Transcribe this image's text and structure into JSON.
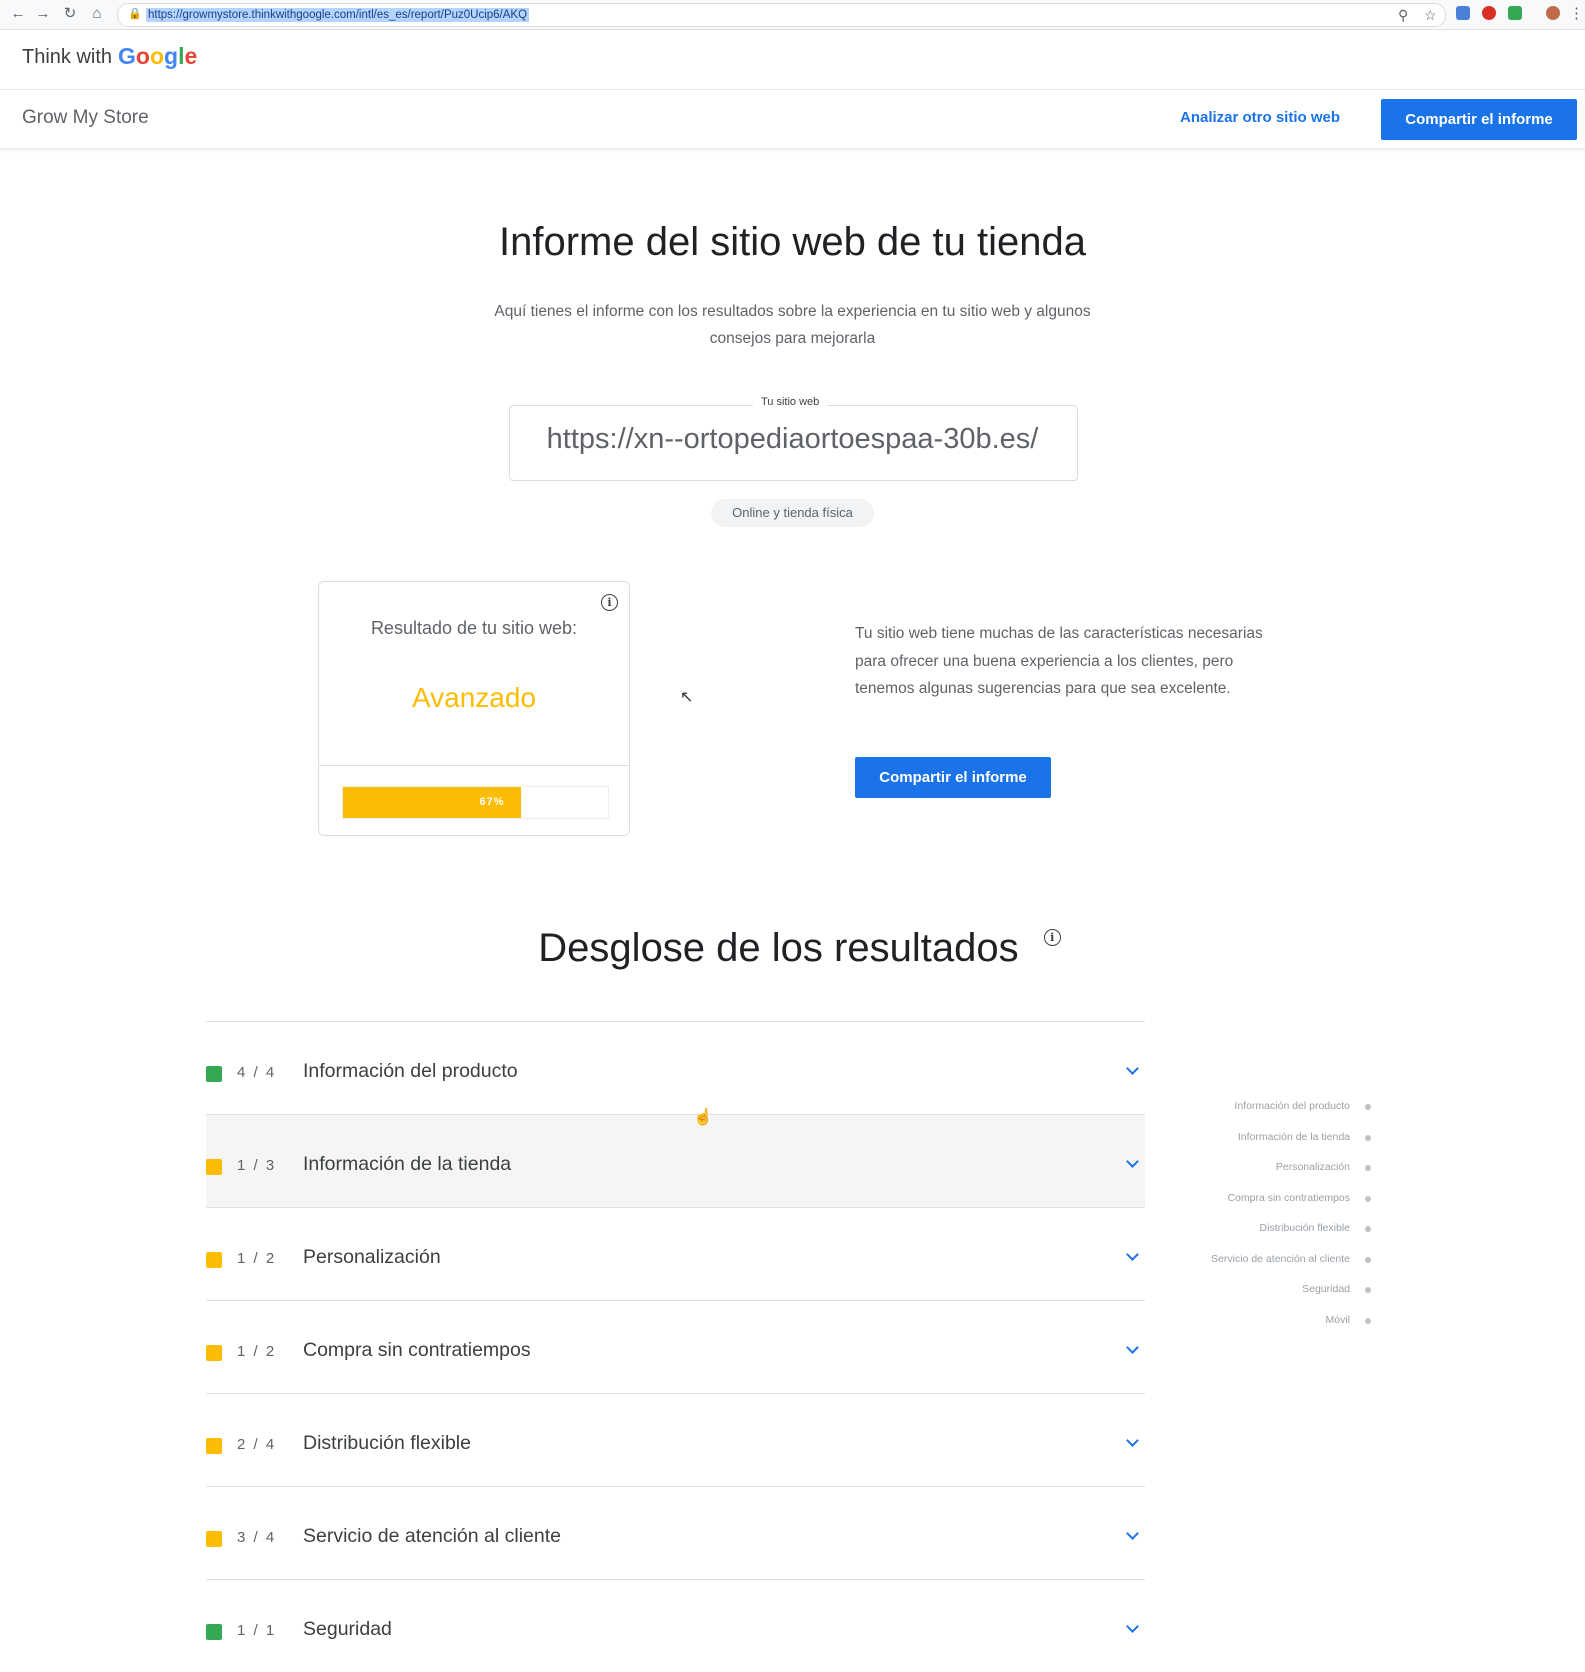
{
  "browser": {
    "url": "https://growmystore.thinkwithgoogle.com/intl/es_es/report/Puz0Ucip6/AKQ"
  },
  "brand": {
    "think_with": "Think with",
    "google": "Google"
  },
  "app_bar": {
    "title": "Grow My Store",
    "analyze_link": "Analizar otro sitio web",
    "share_button": "Compartir el informe"
  },
  "hero": {
    "title": "Informe del sitio web de tu tienda",
    "subtitle": "Aquí tienes el informe con los resultados sobre la experiencia en tu sitio web y algunos consejos para mejorarla",
    "site_label": "Tu sitio web",
    "site_url": "https://xn--ortopediaortoespaa-30b.es/",
    "store_type": "Online y tienda física"
  },
  "score_card": {
    "label": "Resultado de tu sitio web:",
    "value": "Avanzado",
    "progress_percent": 67,
    "progress_text": "67%"
  },
  "summary": {
    "text": "Tu sitio web tiene muchas de las características necesarias para ofrecer una buena experiencia a los clientes, pero tenemos algunas sugerencias para que sea excelente.",
    "share_button": "Compartir el informe"
  },
  "breakdown": {
    "title": "Desglose de los resultados",
    "rows": [
      {
        "score": "4 / 4",
        "name": "Información del producto",
        "status_color": "#34a853"
      },
      {
        "score": "1 / 3",
        "name": "Información de la tienda",
        "status_color": "#fbbc04"
      },
      {
        "score": "1 / 2",
        "name": "Personalización",
        "status_color": "#fbbc04"
      },
      {
        "score": "1 / 2",
        "name": "Compra sin contratiempos",
        "status_color": "#fbbc04"
      },
      {
        "score": "2 / 4",
        "name": "Distribución flexible",
        "status_color": "#fbbc04"
      },
      {
        "score": "3 / 4",
        "name": "Servicio de atención al cliente",
        "status_color": "#fbbc04"
      },
      {
        "score": "1 / 1",
        "name": "Seguridad",
        "status_color": "#34a853"
      }
    ],
    "side_nav": [
      "Información del producto",
      "Información de la tienda",
      "Personalización",
      "Compra sin contratiempos",
      "Distribución flexible",
      "Servicio de atención al cliente",
      "Seguridad",
      "Móvil"
    ]
  }
}
